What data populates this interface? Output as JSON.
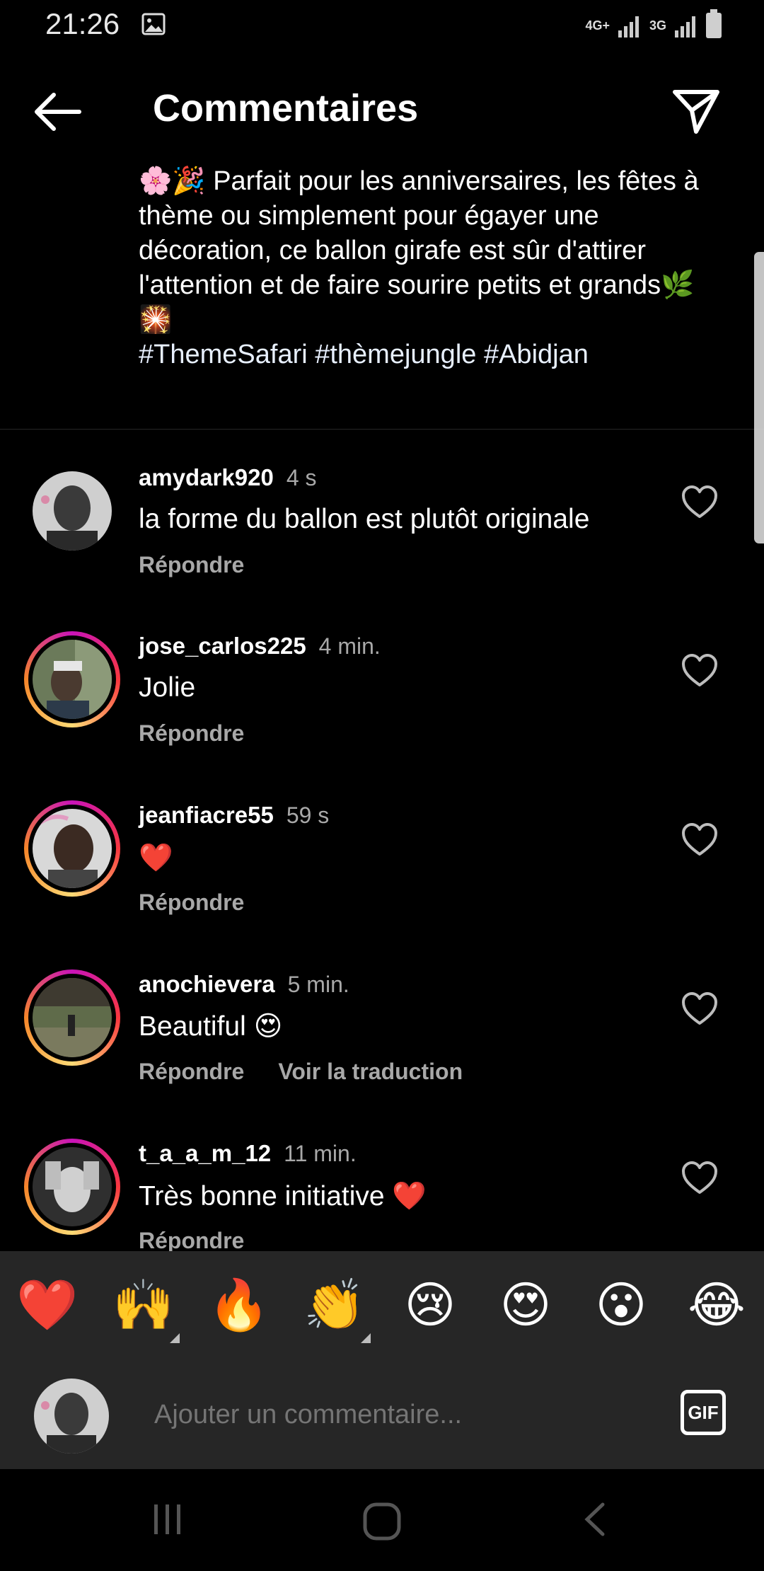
{
  "status_bar": {
    "time": "21:26",
    "network_1": "4G+",
    "network_2": "3G",
    "icons": [
      "gallery-icon",
      "signal-icon",
      "battery-icon"
    ]
  },
  "header": {
    "title": "Commentaires",
    "back_icon": "arrow-left-icon",
    "share_icon": "paper-plane-icon"
  },
  "caption": {
    "emoji_start": "🌸🎉",
    "text": "Parfait pour les anniversaires, les fêtes à thème ou simplement pour égayer une décoration, ce ballon girafe est sûr d'attirer l'attention et de faire sourire petits et grands",
    "emoji_end": "🌿🎇",
    "hashtags": "#ThemeSafari #thèmejungle #Abidjan"
  },
  "comments": [
    {
      "username": "amydark920",
      "time": "4 s",
      "text": "la forme du ballon est plutôt originale",
      "reply": "Répondre",
      "translate": ""
    },
    {
      "username": "jose_carlos225",
      "time": "4 min.",
      "text": "Jolie",
      "reply": "Répondre",
      "translate": ""
    },
    {
      "username": "jeanfiacre55",
      "time": "59 s",
      "text": "❤️",
      "reply": "Répondre",
      "translate": ""
    },
    {
      "username": "anochievera",
      "time": "5 min.",
      "text": "Beautiful 😍",
      "reply": "Répondre",
      "translate": "Voir la traduction"
    },
    {
      "username": "t_a_a_m_12",
      "time": "11 min.",
      "text": "Très bonne initiative ❤️",
      "reply": "Répondre",
      "translate": ""
    }
  ],
  "emoji_bar": [
    "❤️",
    "🙌",
    "🔥",
    "👏",
    "😢",
    "😍",
    "😮",
    "😂"
  ],
  "composer": {
    "placeholder": "Ajouter un commentaire...",
    "gif_label": "GIF"
  },
  "colors": {
    "background": "#000000",
    "secondary_text": "#a8a8a8",
    "panel": "#262626"
  }
}
